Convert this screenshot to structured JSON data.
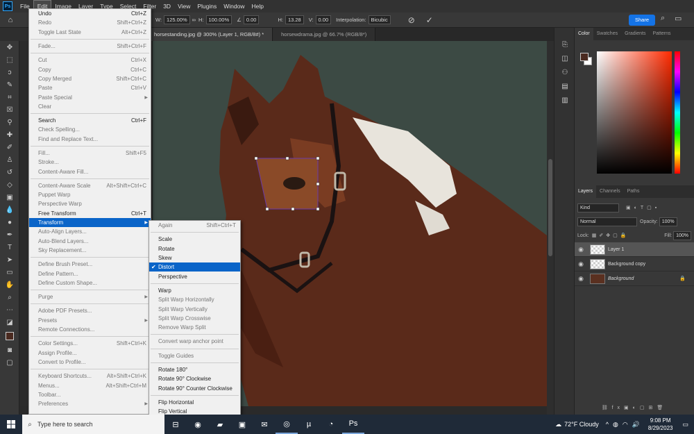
{
  "app": {
    "logo": "Ps",
    "menus": [
      "File",
      "Edit",
      "Image",
      "Layer",
      "Type",
      "Select",
      "Filter",
      "3D",
      "View",
      "Plugins",
      "Window",
      "Help"
    ],
    "active_menu": "Edit"
  },
  "options_bar": {
    "w_label": "W:",
    "w_value": "125.00%",
    "h_label": "H:",
    "h_value": "100.00%",
    "angle_value": "0.00",
    "hskew_label": "H:",
    "hskew_value": "13.28",
    "vskew_label": "V:",
    "vskew_value": "0.00",
    "interp_label": "Interpolation:",
    "interp_value": "Bicubic",
    "share": "Share"
  },
  "tabs": [
    {
      "label": "horsestanding.jpg @ 300% (Layer 1, RGB/8#) *",
      "active": true
    },
    {
      "label": "horsewdrama.jpg @ 66.7% (RGB/8*)",
      "active": false
    }
  ],
  "edit_menu": [
    {
      "label": "Undo",
      "sc": "Ctrl+Z",
      "dis": false
    },
    {
      "label": "Redo",
      "sc": "Shift+Ctrl+Z",
      "dis": true
    },
    {
      "label": "Toggle Last State",
      "sc": "Alt+Ctrl+Z",
      "dis": true
    },
    {
      "sep": true
    },
    {
      "label": "Fade...",
      "sc": "Shift+Ctrl+F",
      "dis": true
    },
    {
      "sep": true
    },
    {
      "label": "Cut",
      "sc": "Ctrl+X",
      "dis": true
    },
    {
      "label": "Copy",
      "sc": "Ctrl+C",
      "dis": true
    },
    {
      "label": "Copy Merged",
      "sc": "Shift+Ctrl+C",
      "dis": true
    },
    {
      "label": "Paste",
      "sc": "Ctrl+V",
      "dis": true
    },
    {
      "label": "Paste Special",
      "sc": "",
      "dis": true,
      "sub": true
    },
    {
      "label": "Clear",
      "sc": "",
      "dis": true
    },
    {
      "sep": true
    },
    {
      "label": "Search",
      "sc": "Ctrl+F",
      "dis": false
    },
    {
      "label": "Check Spelling...",
      "sc": "",
      "dis": true
    },
    {
      "label": "Find and Replace Text...",
      "sc": "",
      "dis": true
    },
    {
      "sep": true
    },
    {
      "label": "Fill...",
      "sc": "Shift+F5",
      "dis": true
    },
    {
      "label": "Stroke...",
      "sc": "",
      "dis": true
    },
    {
      "label": "Content-Aware Fill...",
      "sc": "",
      "dis": true
    },
    {
      "sep": true
    },
    {
      "label": "Content-Aware Scale",
      "sc": "Alt+Shift+Ctrl+C",
      "dis": true
    },
    {
      "label": "Puppet Warp",
      "sc": "",
      "dis": true
    },
    {
      "label": "Perspective Warp",
      "sc": "",
      "dis": true
    },
    {
      "label": "Free Transform",
      "sc": "Ctrl+T",
      "dis": false
    },
    {
      "label": "Transform",
      "sc": "",
      "dis": false,
      "sub": true,
      "hl": true
    },
    {
      "label": "Auto-Align Layers...",
      "sc": "",
      "dis": true
    },
    {
      "label": "Auto-Blend Layers...",
      "sc": "",
      "dis": true
    },
    {
      "label": "Sky Replacement...",
      "sc": "",
      "dis": true
    },
    {
      "sep": true
    },
    {
      "label": "Define Brush Preset...",
      "sc": "",
      "dis": true
    },
    {
      "label": "Define Pattern...",
      "sc": "",
      "dis": true
    },
    {
      "label": "Define Custom Shape...",
      "sc": "",
      "dis": true
    },
    {
      "sep": true
    },
    {
      "label": "Purge",
      "sc": "",
      "dis": true,
      "sub": true
    },
    {
      "sep": true
    },
    {
      "label": "Adobe PDF Presets...",
      "sc": "",
      "dis": true
    },
    {
      "label": "Presets",
      "sc": "",
      "dis": true,
      "sub": true
    },
    {
      "label": "Remote Connections...",
      "sc": "",
      "dis": true
    },
    {
      "sep": true
    },
    {
      "label": "Color Settings...",
      "sc": "Shift+Ctrl+K",
      "dis": true
    },
    {
      "label": "Assign Profile...",
      "sc": "",
      "dis": true
    },
    {
      "label": "Convert to Profile...",
      "sc": "",
      "dis": true
    },
    {
      "sep": true
    },
    {
      "label": "Keyboard Shortcuts...",
      "sc": "Alt+Shift+Ctrl+K",
      "dis": true
    },
    {
      "label": "Menus...",
      "sc": "Alt+Shift+Ctrl+M",
      "dis": true
    },
    {
      "label": "Toolbar...",
      "sc": "",
      "dis": true
    },
    {
      "label": "Preferences",
      "sc": "",
      "dis": true,
      "sub": true
    }
  ],
  "transform_menu": [
    {
      "label": "Again",
      "sc": "Shift+Ctrl+T",
      "dis": true
    },
    {
      "sep": true
    },
    {
      "label": "Scale",
      "sc": "",
      "dis": false
    },
    {
      "label": "Rotate",
      "sc": "",
      "dis": false
    },
    {
      "label": "Skew",
      "sc": "",
      "dis": false
    },
    {
      "label": "Distort",
      "sc": "",
      "dis": false,
      "hl": true,
      "check": true
    },
    {
      "label": "Perspective",
      "sc": "",
      "dis": false
    },
    {
      "sep": true
    },
    {
      "label": "Warp",
      "sc": "",
      "dis": false
    },
    {
      "label": "Split Warp Horizontally",
      "sc": "",
      "dis": true
    },
    {
      "label": "Split Warp Vertically",
      "sc": "",
      "dis": true
    },
    {
      "label": "Split Warp Crosswise",
      "sc": "",
      "dis": true
    },
    {
      "label": "Remove Warp Split",
      "sc": "",
      "dis": true
    },
    {
      "sep": true
    },
    {
      "label": "Convert warp anchor point",
      "sc": "",
      "dis": true
    },
    {
      "sep": true
    },
    {
      "label": "Toggle Guides",
      "sc": "",
      "dis": true
    },
    {
      "sep": true
    },
    {
      "label": "Rotate 180°",
      "sc": "",
      "dis": false
    },
    {
      "label": "Rotate 90° Clockwise",
      "sc": "",
      "dis": false
    },
    {
      "label": "Rotate 90° Counter Clockwise",
      "sc": "",
      "dis": false
    },
    {
      "sep": true
    },
    {
      "label": "Flip Horizontal",
      "sc": "",
      "dis": false
    },
    {
      "label": "Flip Vertical",
      "sc": "",
      "dis": false
    }
  ],
  "color_panel": {
    "tabs": [
      "Color",
      "Swatches",
      "Gradients",
      "Patterns"
    ]
  },
  "layers_panel": {
    "tabs": [
      "Layers",
      "Channels",
      "Paths"
    ],
    "kind": "Kind",
    "blend": "Normal",
    "opacity_label": "Opacity:",
    "opacity": "100%",
    "lock_label": "Lock:",
    "fill_label": "Fill:",
    "fill": "100%",
    "layers": [
      {
        "name": "Layer 1",
        "selected": true
      },
      {
        "name": "Background copy",
        "selected": false
      },
      {
        "name": "Background",
        "selected": false
      }
    ]
  },
  "taskbar": {
    "search_placeholder": "Type here to search",
    "weather": "72°F  Cloudy",
    "time": "9:08 PM",
    "date": "8/29/2023"
  }
}
